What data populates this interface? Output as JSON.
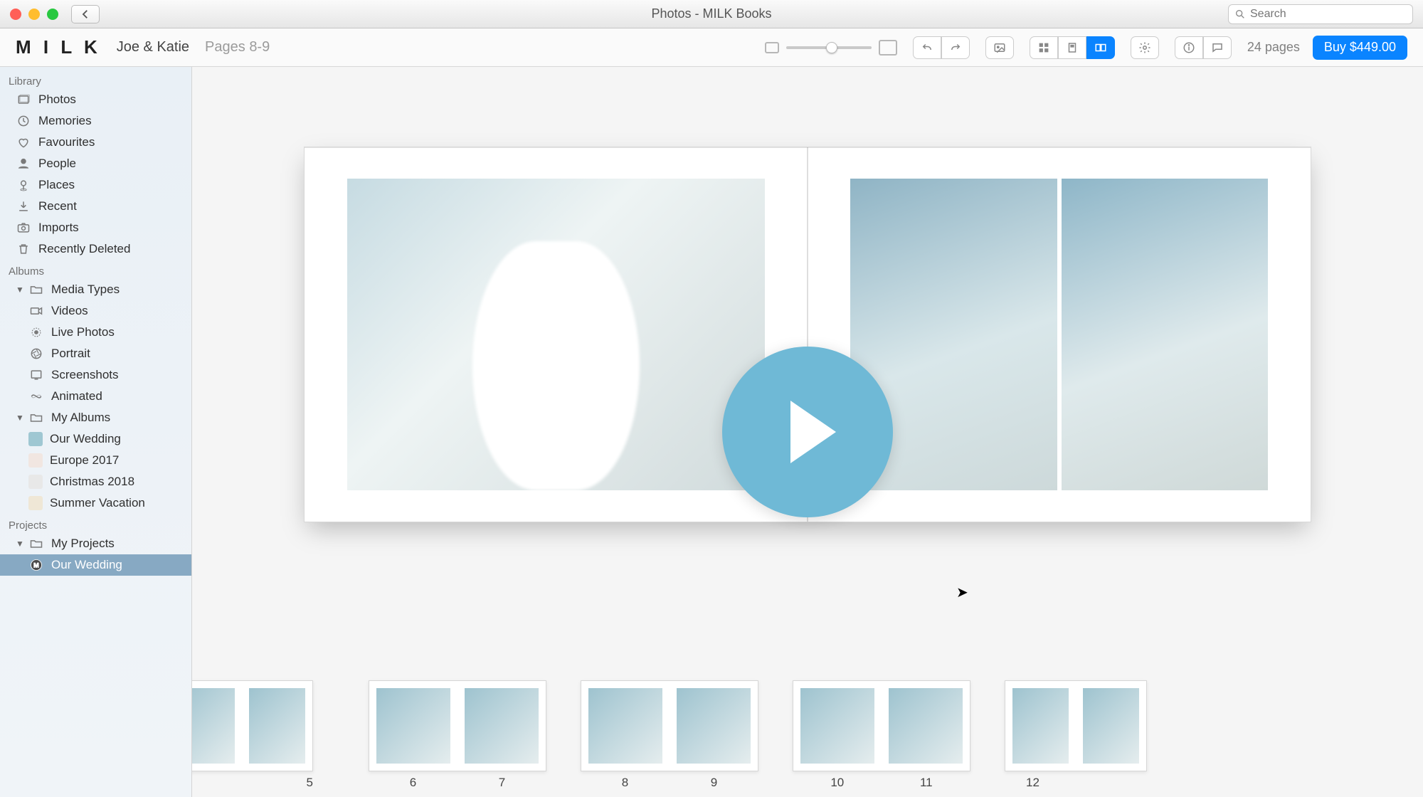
{
  "window": {
    "title": "Photos - MILK Books"
  },
  "search": {
    "placeholder": "Search"
  },
  "toolbar": {
    "brand": "M I L K",
    "project_name": "Joe & Katie",
    "pages_label": "Pages 8-9",
    "pages_count": "24 pages",
    "buy_label": "Buy $449.00"
  },
  "sidebar": {
    "library_heading": "Library",
    "library_items": [
      {
        "icon": "photos",
        "label": "Photos"
      },
      {
        "icon": "memories",
        "label": "Memories"
      },
      {
        "icon": "heart",
        "label": "Favourites"
      },
      {
        "icon": "person",
        "label": "People"
      },
      {
        "icon": "pin",
        "label": "Places"
      },
      {
        "icon": "download",
        "label": "Recent"
      },
      {
        "icon": "camera",
        "label": "Imports"
      },
      {
        "icon": "trash",
        "label": "Recently Deleted"
      }
    ],
    "albums_heading": "Albums",
    "media_types_label": "Media Types",
    "media_types": [
      {
        "icon": "video",
        "label": "Videos"
      },
      {
        "icon": "live",
        "label": "Live Photos"
      },
      {
        "icon": "portrait",
        "label": "Portrait"
      },
      {
        "icon": "screenshot",
        "label": "Screenshots"
      },
      {
        "icon": "animated",
        "label": "Animated"
      }
    ],
    "my_albums_label": "My Albums",
    "my_albums": [
      {
        "swatch": "#9fc7d2",
        "label": "Our Wedding"
      },
      {
        "swatch": "#f0e3e3",
        "label": "Europe 2017"
      },
      {
        "swatch": "#e6e6e6",
        "label": "Christmas 2018"
      },
      {
        "swatch": "#f1e8d8",
        "label": "Summer Vacation"
      }
    ],
    "projects_heading": "Projects",
    "my_projects_label": "My Projects",
    "projects": [
      {
        "icon": "milk",
        "label": "Our Wedding",
        "selected": true
      }
    ]
  },
  "thumbs": {
    "numbers": [
      "5",
      "6",
      "7",
      "8",
      "9",
      "10",
      "11",
      "12"
    ]
  }
}
